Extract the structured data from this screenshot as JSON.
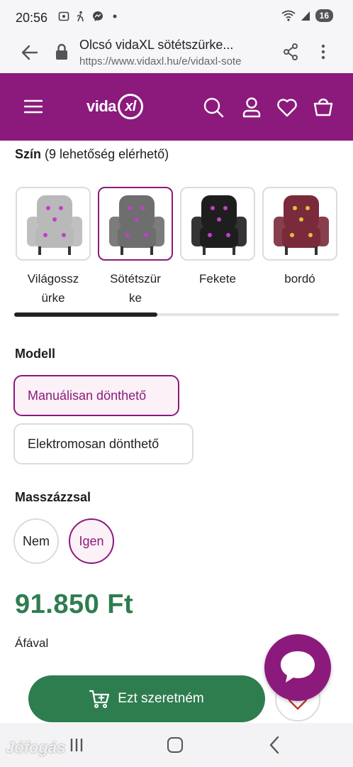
{
  "status_bar": {
    "time": "20:56",
    "battery": "16"
  },
  "browser": {
    "page_title": "Olcsó vidaXL sötétszürke...",
    "url": "https://www.vidaxl.hu/e/vidaxl-sote"
  },
  "header": {
    "logo": "vida",
    "logo_mark": "xl",
    "brand_color": "#8b1a7c"
  },
  "color_section": {
    "label": "Szín",
    "count_text": "(9 lehetőség elérhető)",
    "swatches": [
      {
        "label": "Világossz\nürke",
        "color": "#b9b9b9",
        "selected": false
      },
      {
        "label": "Sötétszür\nke",
        "color": "#6e6e6e",
        "selected": true
      },
      {
        "label": "Fekete",
        "color": "#1e1e1e",
        "selected": false
      },
      {
        "label": "bordó",
        "color": "#7a2a3a",
        "selected": false
      }
    ]
  },
  "model_section": {
    "heading": "Modell",
    "options": [
      {
        "label": "Manuálisan dönthető",
        "selected": true
      },
      {
        "label": "Elektromosan dönthető",
        "selected": false
      }
    ]
  },
  "massage_section": {
    "heading": "Masszázzsal",
    "options": [
      {
        "label": "Nem",
        "selected": false
      },
      {
        "label": "Igen",
        "selected": true
      }
    ]
  },
  "price": {
    "value": "91.850 Ft",
    "vat_note": "Áfával",
    "color": "#2e7d4f"
  },
  "actions": {
    "add_to_cart": "Ezt szeretném"
  },
  "watermark": "Jófogás"
}
